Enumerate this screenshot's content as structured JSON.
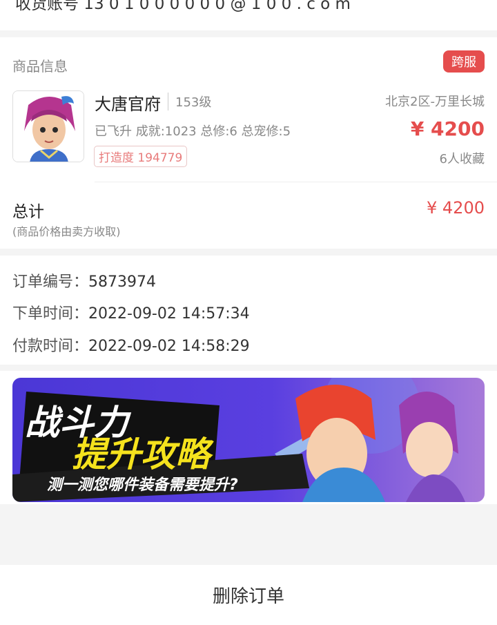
{
  "top": {
    "partial_text": "收货账号 13 0 1 0 0 0 0 0 0 @ 1 0 0 . c o m"
  },
  "product": {
    "section_title": "商品信息",
    "badge": "跨服",
    "role_name": "大唐官府",
    "level": "153级",
    "server": "北京2区-万里长城",
    "attrs": "已飞升 成就:1023 总修:6 总宠修:5",
    "price": "¥ 4200",
    "build_tag": "打造度 194779",
    "favorites": "6人收藏",
    "avatar_icon": "character-portrait"
  },
  "total": {
    "label": "总计",
    "note": "(商品价格由卖方收取)",
    "price": "¥ 4200"
  },
  "order": {
    "number_label": "订单编号：",
    "number": "5873974",
    "created_label": "下单时间：",
    "created": "2022-09-02 14:57:34",
    "paid_label": "付款时间：",
    "paid": "2022-09-02 14:58:29"
  },
  "banner": {
    "line1": "战斗力",
    "line2": "提升攻略",
    "line3": "测一测您哪件装备需要提升?"
  },
  "actions": {
    "delete_label": "删除订单"
  },
  "colors": {
    "accent_red": "#e54d4d",
    "background": "#f4f4f4"
  }
}
